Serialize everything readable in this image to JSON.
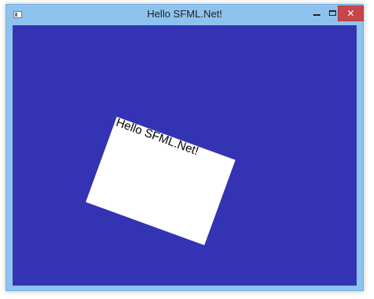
{
  "window": {
    "title": "Hello SFML.Net!",
    "controls": {
      "minimize": "–",
      "maximize": "□",
      "close": "✕"
    }
  },
  "canvas": {
    "background_color": "#3333b3",
    "sprite": {
      "color": "#ffffff",
      "rotation_degrees": 20,
      "text": "Hello SFML.Net!"
    }
  }
}
